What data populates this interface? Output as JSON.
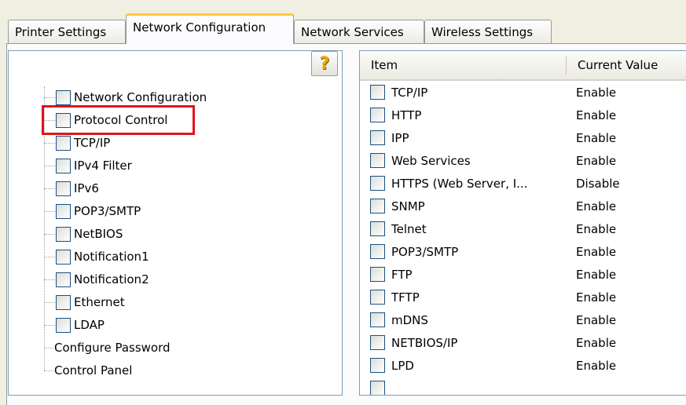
{
  "tabs": [
    {
      "label": "Printer Settings",
      "active": false
    },
    {
      "label": "Network Configuration",
      "active": true
    },
    {
      "label": "Network Services",
      "active": false
    },
    {
      "label": "Wireless Settings",
      "active": false
    }
  ],
  "help_button": {
    "glyph": "?",
    "icon": "help-icon"
  },
  "tree": {
    "items": [
      {
        "label": "Network Configuration",
        "checkbox": true
      },
      {
        "label": "Protocol Control",
        "checkbox": true,
        "highlighted": true
      },
      {
        "label": "TCP/IP",
        "checkbox": true
      },
      {
        "label": "IPv4 Filter",
        "checkbox": true
      },
      {
        "label": "IPv6",
        "checkbox": true
      },
      {
        "label": "POP3/SMTP",
        "checkbox": true
      },
      {
        "label": "NetBIOS",
        "checkbox": true
      },
      {
        "label": "Notification1",
        "checkbox": true
      },
      {
        "label": "Notification2",
        "checkbox": true
      },
      {
        "label": "Ethernet",
        "checkbox": true
      },
      {
        "label": "LDAP",
        "checkbox": true
      },
      {
        "label": "Configure Password",
        "checkbox": false
      },
      {
        "label": "Control Panel",
        "checkbox": false
      }
    ]
  },
  "list": {
    "columns": [
      "Item",
      "Current Value"
    ],
    "rows": [
      {
        "item": "TCP/IP",
        "value": "Enable"
      },
      {
        "item": "HTTP",
        "value": "Enable"
      },
      {
        "item": "IPP",
        "value": "Enable"
      },
      {
        "item": "Web Services",
        "value": "Enable"
      },
      {
        "item": "HTTPS (Web Server, I...",
        "value": "Disable"
      },
      {
        "item": "SNMP",
        "value": "Enable"
      },
      {
        "item": "Telnet",
        "value": "Enable"
      },
      {
        "item": "POP3/SMTP",
        "value": "Enable"
      },
      {
        "item": "FTP",
        "value": "Enable"
      },
      {
        "item": "TFTP",
        "value": "Enable"
      },
      {
        "item": "mDNS",
        "value": "Enable"
      },
      {
        "item": "NETBIOS/IP",
        "value": "Enable"
      },
      {
        "item": "LPD",
        "value": "Enable"
      }
    ]
  },
  "colors": {
    "highlight": "#e0141c",
    "active_tab_accent": "#ffc83c"
  }
}
